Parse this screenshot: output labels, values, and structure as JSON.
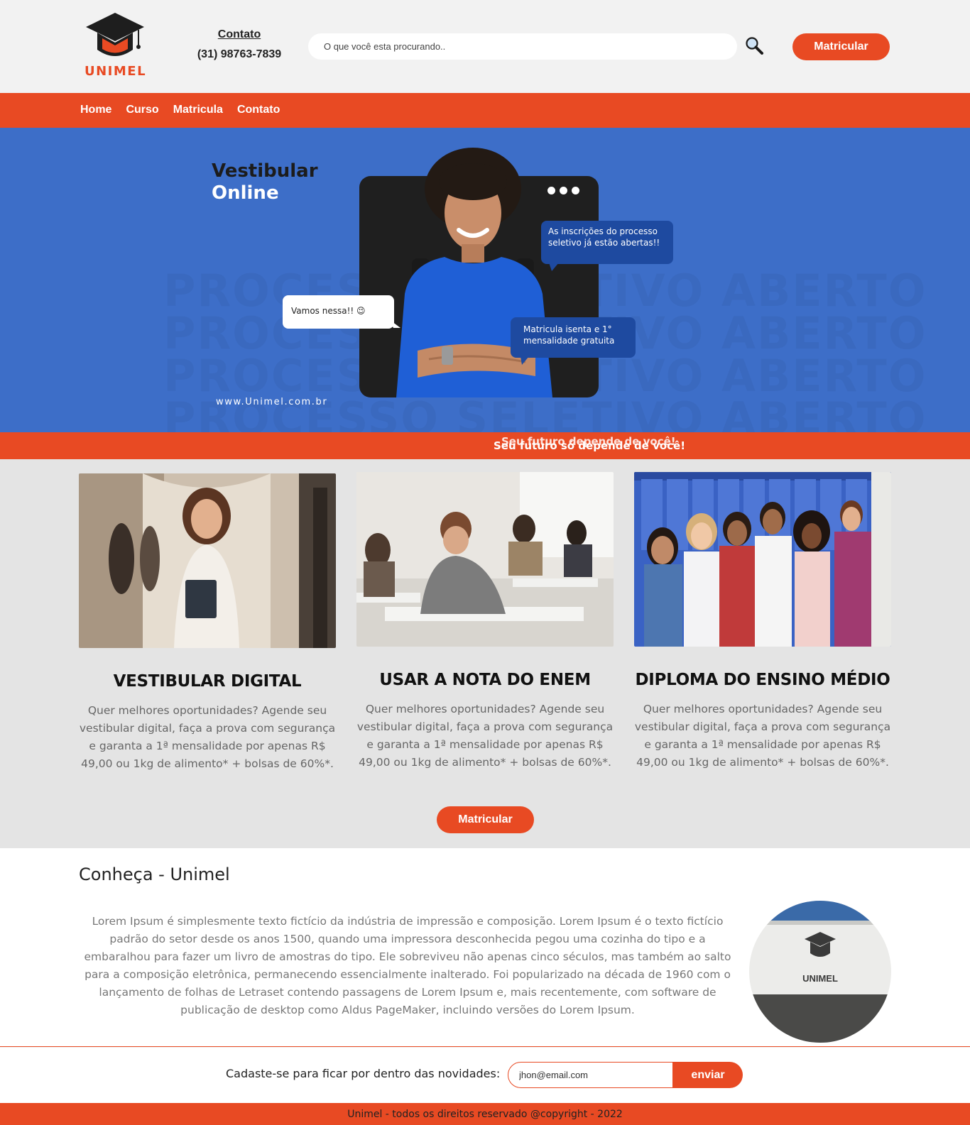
{
  "header": {
    "logo_text": "UNIMEL",
    "contact_title": "Contato",
    "contact_phone": "(31) 98763-7839",
    "search_placeholder": "O que você esta procurando..",
    "cta_label": "Matricular"
  },
  "nav": {
    "items": [
      {
        "label": "Home"
      },
      {
        "label": "Curso"
      },
      {
        "label": "Matricula"
      },
      {
        "label": "Contato"
      }
    ]
  },
  "hero": {
    "title_line1": "Vestibular",
    "title_line2": "Online",
    "bubble_top": "As inscrições do processo seletivo já estão abertas!!",
    "bubble_left": "Vamos nessa!! 😉",
    "bubble_bottom": "Matricula isenta e 1° mensalidade gratuita",
    "url": "www.Unimel.com.br",
    "watermark": "PROCESSO SELETIVO ABERTO"
  },
  "ticker": {
    "text": "Seu futuro só depende de você!",
    "ghost": "Seu futuro depende de você!"
  },
  "courses": {
    "items": [
      {
        "title": "VESTIBULAR DIGITAL",
        "text": "Quer melhores oportunidades? Agende seu vestibular digital, faça a prova com segurança e garanta a 1ª mensalidade por apenas R$ 49,00 ou 1kg de alimento* + bolsas de 60%*."
      },
      {
        "title": "USAR A NOTA DO ENEM",
        "text": "Quer melhores oportunidades? Agende seu vestibular digital, faça a prova com segurança e garanta a 1ª mensalidade por apenas R$ 49,00 ou 1kg de alimento* + bolsas de 60%*."
      },
      {
        "title": "DIPLOMA DO ENSINO MÉDIO",
        "text": "Quer melhores oportunidades? Agende seu vestibular digital, faça a prova com segurança e garanta a 1ª mensalidade por apenas R$ 49,00 ou 1kg de alimento* + bolsas de 60%*."
      }
    ],
    "cta_label": "Matricular"
  },
  "about": {
    "title": "Conheça - Unimel",
    "text": "Lorem Ipsum é simplesmente texto fictício da indústria de impressão e composição. Lorem Ipsum é o texto fictício padrão do setor desde os anos 1500, quando uma impressora desconhecida pegou uma cozinha do tipo e a embaralhou para fazer um livro de amostras do tipo. Ele sobreviveu não apenas cinco séculos, mas também ao salto para a composição eletrônica, permanecendo essencialmente inalterado. Foi popularizado na década de 1960 com o lançamento de folhas de Letraset contendo passagens de Lorem Ipsum e, mais recentemente, com software de publicação de desktop como Aldus PageMaker, incluindo versões do Lorem Ipsum.",
    "sign_text": "UNIMEL"
  },
  "newsletter": {
    "label": "Cadaste-se para ficar por dentro das novidades:",
    "placeholder": "jhon@email.com",
    "button_label": "enviar"
  },
  "footer": {
    "text": "Unimel - todos os direitos reservado @copyright - 2022"
  },
  "colors": {
    "accent": "#e84a23",
    "hero_blue": "#3d6ec8",
    "bubble_blue": "#1e4aa0"
  }
}
